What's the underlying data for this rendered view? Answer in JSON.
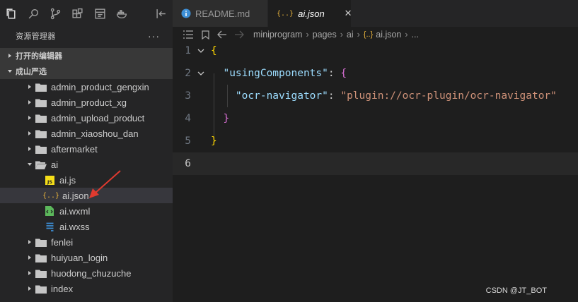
{
  "activity_bar": {
    "icons": [
      "files-icon",
      "search-icon",
      "source-control-icon",
      "extensions-icon",
      "devtools-icon",
      "docker-icon",
      "panel-toggle-icon"
    ]
  },
  "explorer": {
    "title": "资源管理器",
    "more": "···",
    "section_open_editors": "打开的编辑器",
    "section_project": "成山严选"
  },
  "tree": [
    {
      "label": "admin_product_gengxin",
      "type": "folder"
    },
    {
      "label": "admin_product_xg",
      "type": "folder"
    },
    {
      "label": "admin_upload_product",
      "type": "folder"
    },
    {
      "label": "admin_xiaoshou_dan",
      "type": "folder"
    },
    {
      "label": "aftermarket",
      "type": "folder"
    },
    {
      "label": "ai",
      "type": "folder-open"
    },
    {
      "label": "ai.js",
      "type": "js"
    },
    {
      "label": "ai.json",
      "type": "json"
    },
    {
      "label": "ai.wxml",
      "type": "wxml"
    },
    {
      "label": "ai.wxss",
      "type": "wxss"
    },
    {
      "label": "fenlei",
      "type": "folder"
    },
    {
      "label": "huiyuan_login",
      "type": "folder"
    },
    {
      "label": "huodong_chuzuche",
      "type": "folder"
    },
    {
      "label": "index",
      "type": "folder"
    }
  ],
  "tabs": [
    {
      "label": "README.md"
    },
    {
      "label": "ai.json",
      "close": "✕"
    }
  ],
  "breadcrumb": {
    "parts": [
      "miniprogram",
      "pages",
      "ai"
    ],
    "file": "ai.json",
    "more": "..."
  },
  "code": {
    "line_numbers": [
      "1",
      "2",
      "3",
      "4",
      "5",
      "6"
    ],
    "l1": "{",
    "l2_key": "\"usingComponents\"",
    "l2_colon": ": ",
    "l2_brace": "{",
    "l3_key": "\"ocr-navigator\"",
    "l3_colon": ": ",
    "l3_value": "\"plugin://ocr-plugin/ocr-navigator\"",
    "l4": "}",
    "l5": "}"
  },
  "watermark": "CSDN @JT_BOT",
  "colors": {
    "accent_arrow": "#e03a2f",
    "json_icon": "#e8b33c",
    "js_icon": "#f5de19",
    "wxml_icon": "#5cb85c",
    "wxss_icon": "#3d8fd6"
  }
}
